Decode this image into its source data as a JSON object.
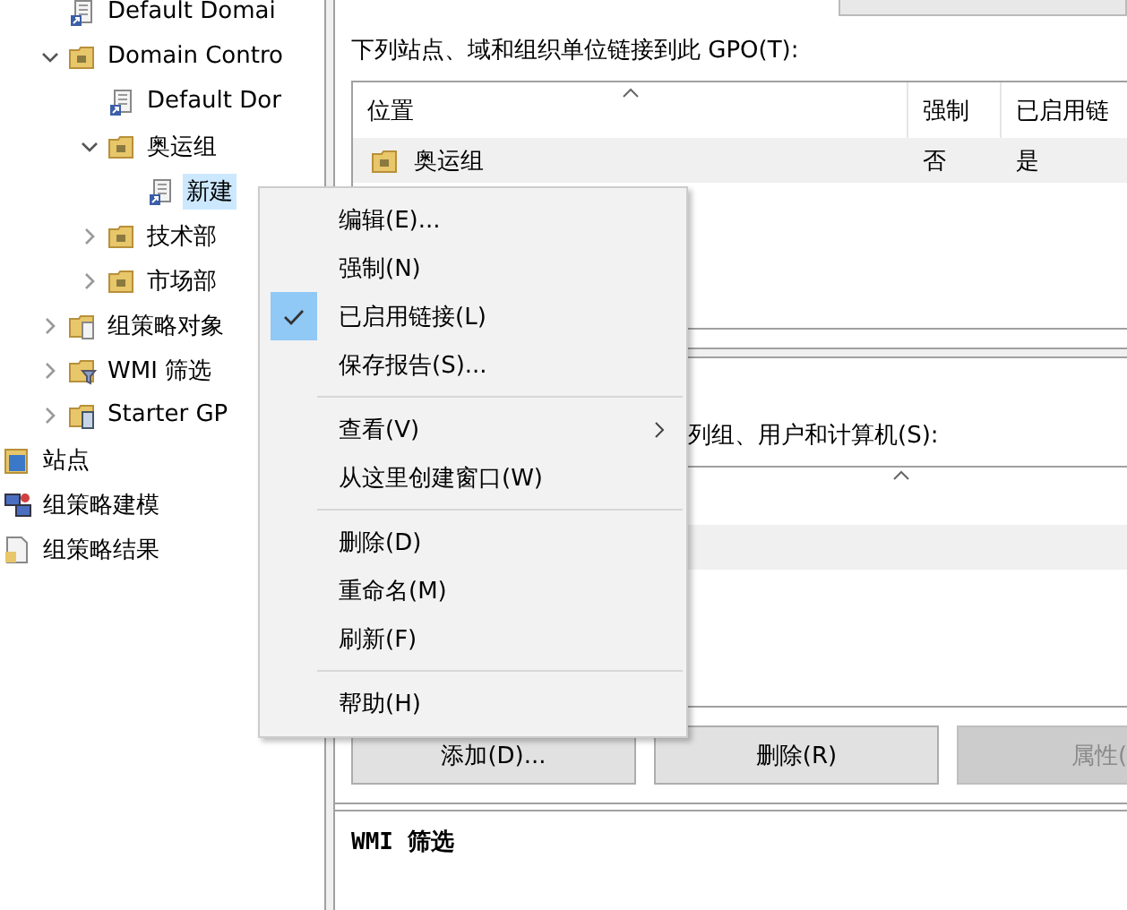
{
  "tree": [
    {
      "children": [
        {
          "label": "Default Domai",
          "kind": "gpo",
          "selected": false
        },
        {
          "label": "Domain Contro",
          "kind": "ou",
          "expanded": true,
          "selected": false,
          "children": [
            {
              "label": "Default Dor",
              "kind": "gpo",
              "selected": false
            },
            {
              "label": "奥运组",
              "kind": "ou",
              "expanded": true,
              "selected": false,
              "children": [
                {
                  "label": "新建",
                  "kind": "gpo",
                  "selected": true
                }
              ]
            },
            {
              "label": "技术部",
              "kind": "ou",
              "expanded": false,
              "selected": false
            },
            {
              "label": "市场部",
              "kind": "ou",
              "expanded": false,
              "selected": false
            }
          ]
        },
        {
          "label": "组策略对象",
          "kind": "gpo-folder",
          "expanded": false,
          "selected": false
        },
        {
          "label": "WMI 筛选",
          "kind": "filter-folder",
          "expanded": false,
          "selected": false
        },
        {
          "label": "Starter GP",
          "kind": "starter-folder",
          "expanded": false,
          "selected": false
        }
      ]
    },
    {
      "label": "站点",
      "kind": "sites",
      "selected": false
    },
    {
      "label": "组策略建模",
      "kind": "modeling",
      "selected": false
    },
    {
      "label": "组策略结果",
      "kind": "results",
      "selected": false
    }
  ],
  "links": {
    "label": "下列站点、域和组织单位链接到此 GPO(T):",
    "columns": [
      "位置",
      "强制",
      "已启用链"
    ],
    "rows": [
      {
        "cells": [
          "奥运组",
          "否",
          "是"
        ],
        "selected": true
      }
    ]
  },
  "security": {
    "label": "列组、用户和计算机(S):",
    "rows": [
      {
        "selected": true
      }
    ],
    "buttons": [
      {
        "label": "添加(D)...",
        "disabled": false
      },
      {
        "label": "删除(R)",
        "disabled": false
      },
      {
        "label": "属性(",
        "disabled": true
      }
    ]
  },
  "wmi": {
    "title": "WMI 筛选"
  },
  "menu": [
    {
      "kind": "item",
      "label": "编辑(E)...",
      "checked": false
    },
    {
      "kind": "item",
      "label": "强制(N)",
      "checked": false
    },
    {
      "kind": "item",
      "label": "已启用链接(L)",
      "checked": true
    },
    {
      "kind": "item",
      "label": "保存报告(S)...",
      "checked": false
    },
    {
      "kind": "separator"
    },
    {
      "kind": "submenu",
      "label": "查看(V)",
      "checked": false
    },
    {
      "kind": "item",
      "label": "从这里创建窗口(W)",
      "checked": false
    },
    {
      "kind": "separator"
    },
    {
      "kind": "item",
      "label": "删除(D)",
      "checked": false
    },
    {
      "kind": "item",
      "label": "重命名(M)",
      "checked": false
    },
    {
      "kind": "item",
      "label": "刷新(F)",
      "checked": false
    },
    {
      "kind": "separator"
    },
    {
      "kind": "item",
      "label": "帮助(H)",
      "checked": false
    }
  ]
}
